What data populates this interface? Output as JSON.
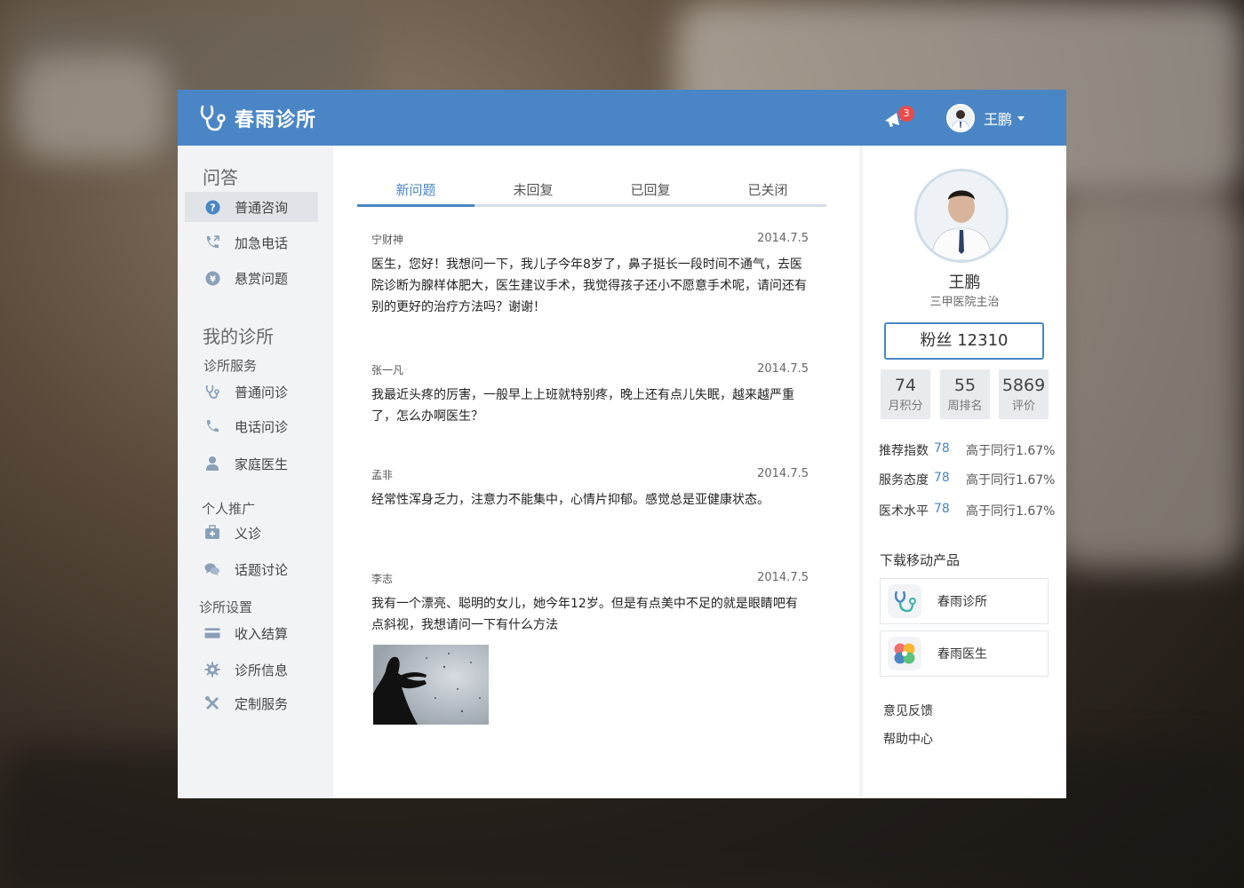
{
  "header": {
    "brand": "春雨诊所",
    "notification_count": "3",
    "user_name": "王鹏",
    "accent_color": "#4a86c5"
  },
  "sidebar": {
    "qa_title": "问答",
    "qa_items": [
      {
        "label": "普通咨询",
        "icon": "question-circle-icon"
      },
      {
        "label": "加急电话",
        "icon": "phone-forward-icon"
      },
      {
        "label": "悬赏问题",
        "icon": "coin-yuan-icon"
      }
    ],
    "clinic_title": "我的诊所",
    "service_title": "诊所服务",
    "service_items": [
      {
        "label": "普通问诊",
        "icon": "stethoscope-icon"
      },
      {
        "label": "电话问诊",
        "icon": "phone-icon"
      },
      {
        "label": "家庭医生",
        "icon": "person-icon"
      }
    ],
    "promo_title": "个人推广",
    "promo_items": [
      {
        "label": "义诊",
        "icon": "medkit-icon"
      },
      {
        "label": "话题讨论",
        "icon": "chat-bubbles-icon"
      }
    ],
    "settings_title": "诊所设置",
    "settings_items": [
      {
        "label": "收入结算",
        "icon": "credit-card-icon"
      },
      {
        "label": "诊所信息",
        "icon": "gear-icon"
      },
      {
        "label": "定制服务",
        "icon": "tools-icon"
      }
    ]
  },
  "tabs": [
    "新问题",
    "未回复",
    "已回复",
    "已关闭"
  ],
  "posts": [
    {
      "author": "宁财神",
      "date": "2014.7.5",
      "text": "医生，您好！我想问一下，我儿子今年8岁了，鼻子挺长一段时间不通气，去医院诊断为腺样体肥大，医生建议手术，我觉得孩子还小不愿意手术呢，请问还有别的更好的治疗方法吗？谢谢！"
    },
    {
      "author": "张一凡",
      "date": "2014.7.5",
      "text": "我最近头疼的厉害，一般早上上班就特别疼，晚上还有点儿失眠，越来越严重了，怎么办啊医生？"
    },
    {
      "author": "孟非",
      "date": "2014.7.5",
      "text": "经常性浑身乏力，注意力不能集中，心情片抑郁。感觉总是亚健康状态。"
    },
    {
      "author": "李志",
      "date": "2014.7.5",
      "text": "我有一个漂亮、聪明的女儿，她今年12岁。但是有点美中不足的就是眼睛吧有点斜视，我想请问一下有什么方法"
    }
  ],
  "profile": {
    "name": "王鹏",
    "title": "三甲医院主治",
    "fans": "粉丝 12310",
    "stats": [
      {
        "value": "74",
        "label": "月积分"
      },
      {
        "value": "55",
        "label": "周排名"
      },
      {
        "value": "5869",
        "label": "评价"
      }
    ],
    "metrics": [
      {
        "label": "推荐指数",
        "value": "78",
        "compare": "高于同行1.67%"
      },
      {
        "label": "服务态度",
        "value": "78",
        "compare": "高于同行1.67%"
      },
      {
        "label": "医术水平",
        "value": "78",
        "compare": "高于同行1.67%"
      }
    ]
  },
  "downloads": {
    "title": "下载移动产品",
    "apps": [
      {
        "name": "春雨诊所",
        "icon": "stethoscope-app-icon"
      },
      {
        "name": "春雨医生",
        "icon": "clover-app-icon"
      }
    ]
  },
  "links": [
    "意见反馈",
    "帮助中心"
  ]
}
